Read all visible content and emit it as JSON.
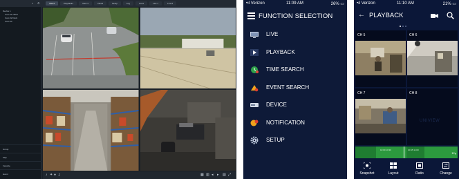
{
  "desktop": {
    "tabs": [
      "View1",
      "Playback1",
      "View 3",
      "View4",
      "Setup",
      "Log",
      "Live1",
      "Live 1",
      "Live 8"
    ],
    "sidebar_tree": [
      "Device 1",
      "Cam 01 Office",
      "Cam 02 Dock",
      "Cam 03"
    ],
    "sidebar_bottom": [
      "Group",
      "Map",
      "Favorite",
      "Event"
    ],
    "cameras": [
      "parking-lot",
      "rooftop",
      "warehouse-shelves",
      "office-room"
    ]
  },
  "function_selection": {
    "status": {
      "carrier": "Verizon",
      "time": "11:09 AM",
      "battery": "26%"
    },
    "title": "FUNCTION SELECTION",
    "items": [
      {
        "label": "LIVE",
        "icon": "live-monitor-icon"
      },
      {
        "label": "PLAYBACK",
        "icon": "playback-icon"
      },
      {
        "label": "TIME SEARCH",
        "icon": "time-search-icon"
      },
      {
        "label": "EVENT SEARCH",
        "icon": "event-search-icon"
      },
      {
        "label": "DEVICE",
        "icon": "device-icon"
      },
      {
        "label": "NOTIFICATION",
        "icon": "notification-icon"
      },
      {
        "label": "SETUP",
        "icon": "gear-icon"
      }
    ]
  },
  "playback": {
    "status": {
      "carrier": "Verizon",
      "time": "11:10 AM",
      "battery": "21%"
    },
    "title": "PLAYBACK",
    "channels": [
      "CH 5",
      "CH 6",
      "CH 7",
      "CH 8"
    ],
    "watermark": "UNIVIEW",
    "timeline": {
      "left_label": "10:00 10:30",
      "mid_label": "10:45 11:00",
      "end_label": "12p"
    },
    "toolbar": [
      "Snapshot",
      "Layout",
      "Ratio",
      "Change"
    ],
    "colors": {
      "background": "#0b1738",
      "timeline": "#2c9a3e"
    }
  }
}
